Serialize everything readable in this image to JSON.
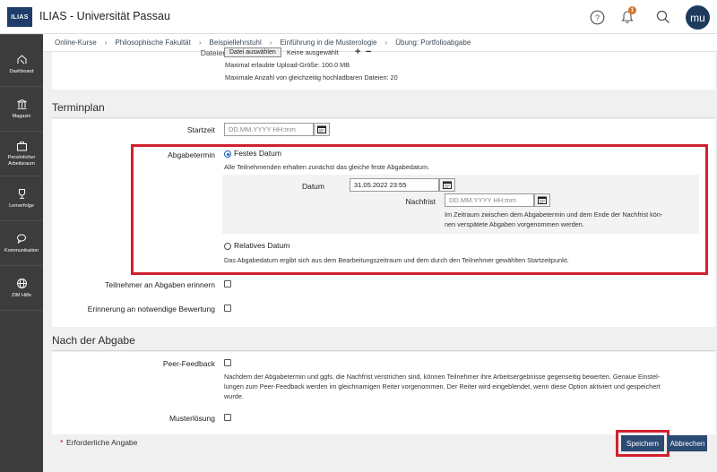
{
  "header": {
    "logo": "ILIAS",
    "title": "ILIAS - Universität Passau",
    "notification_count": "1",
    "avatar_initials": "mu"
  },
  "breadcrumb": [
    "Online-Kurse",
    "Philosophische Fakultät",
    "Beispiellehrstuhl",
    "Einführung in die Musterologie",
    "Übung: Portfolioabgabe"
  ],
  "sidebar": {
    "items": [
      {
        "label": "Dashboard",
        "icon": "dashboard-icon"
      },
      {
        "label": "Magazin",
        "icon": "library-icon"
      },
      {
        "label": "Persönlicher Arbeitsraum",
        "icon": "workspace-icon"
      },
      {
        "label": "Lernerfolge",
        "icon": "trophy-icon"
      },
      {
        "label": "Kommunikation",
        "icon": "chat-icon"
      },
      {
        "label": "ZIM Hilfe",
        "icon": "globe-icon"
      }
    ]
  },
  "upload": {
    "label": "Dateien",
    "button": "Datei auswählen",
    "no_file": "Keine ausgewählt",
    "max_size": "Maximal erlaubte Upload-Größe: 100.0 MB",
    "max_count": "Maximale Anzahl von gleichzeitig hochladbaren Dateien: 20"
  },
  "terminplan": {
    "heading": "Terminplan",
    "startzeit_label": "Startzeit",
    "startzeit_placeholder": "DD.MM.YYYY HH:mm",
    "abgabetermin_label": "Abgabetermin",
    "festes_datum": "Festes Datum",
    "festes_datum_info": "Alle Teilnehmenden erhalten zunächst das gleiche feste Abgabedatum.",
    "datum_label": "Datum",
    "datum_value": "31.05.2022 23:55",
    "nachfrist_label": "Nachfrist",
    "nachfrist_placeholder": "DD.MM.YYYY HH:mm",
    "nachfrist_info_1": "Im Zeitraum zwischen dem Abgabetermin und dem Ende der Nachfrist kön-",
    "nachfrist_info_2": "nen verspätete Abgaben vorgenommen werden.",
    "relatives_datum": "Relatives Datum",
    "relatives_datum_info": "Das Abgabedatum ergibt sich aus dem Bearbeitungszeitraum und dem durch den Teilnehmer gewählten Startzeitpunkt.",
    "erinnern_label": "Teilnehmer an Abgaben erinnern",
    "bewertung_label": "Erinnerung an notwendige Bewertung"
  },
  "nach_abgabe": {
    "heading": "Nach der Abgabe",
    "peer_label": "Peer-Feedback",
    "peer_info_1": "Nachdem der Abgabetermin und ggfs. die Nachfrist verstrichen sind, können Teilnehmer ihre Arbeitsergebnisse gegenseitig bewerten. Genaue Einstel-",
    "peer_info_2": "lungen zum Peer-Feedback werden im gleichnamigen Reiter vorgenommen. Der Reiter wird eingeblendet, wenn diese Option aktiviert und gespeichert",
    "peer_info_3": "wurde.",
    "muster_label": "Musterlösung"
  },
  "footer": {
    "required_star": "*",
    "required": "Erforderliche Angabe",
    "save": "Speichern",
    "cancel": "Abbrechen"
  },
  "colors": {
    "primary": "#2c4a73",
    "highlight": "#d1202f",
    "sidebar": "#3c3c3c"
  }
}
